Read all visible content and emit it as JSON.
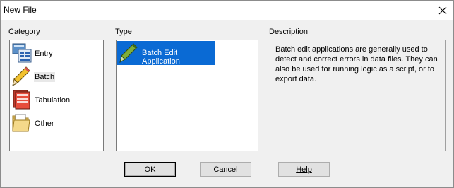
{
  "window": {
    "title": "New File",
    "close_icon": "close-icon"
  },
  "category": {
    "label": "Category",
    "items": [
      {
        "label": "Entry",
        "icon": "form-entry-icon"
      },
      {
        "label": "Batch",
        "icon": "pencil-icon",
        "selected": true
      },
      {
        "label": "Tabulation",
        "icon": "tabulation-icon"
      },
      {
        "label": "Other",
        "icon": "folder-icon"
      }
    ]
  },
  "type": {
    "label": "Type",
    "items": [
      {
        "label": "Batch Edit Application",
        "icon": "pencil-icon",
        "selected": true
      }
    ]
  },
  "description": {
    "label": "Description",
    "text": "Batch edit applications are generally used to detect and correct errors in data files. They can also be used for running logic as a script, or to export data."
  },
  "buttons": {
    "ok": "OK",
    "cancel": "Cancel",
    "help": "Help"
  },
  "colors": {
    "selection": "#0a6ad4",
    "background": "#f0f0f0"
  }
}
